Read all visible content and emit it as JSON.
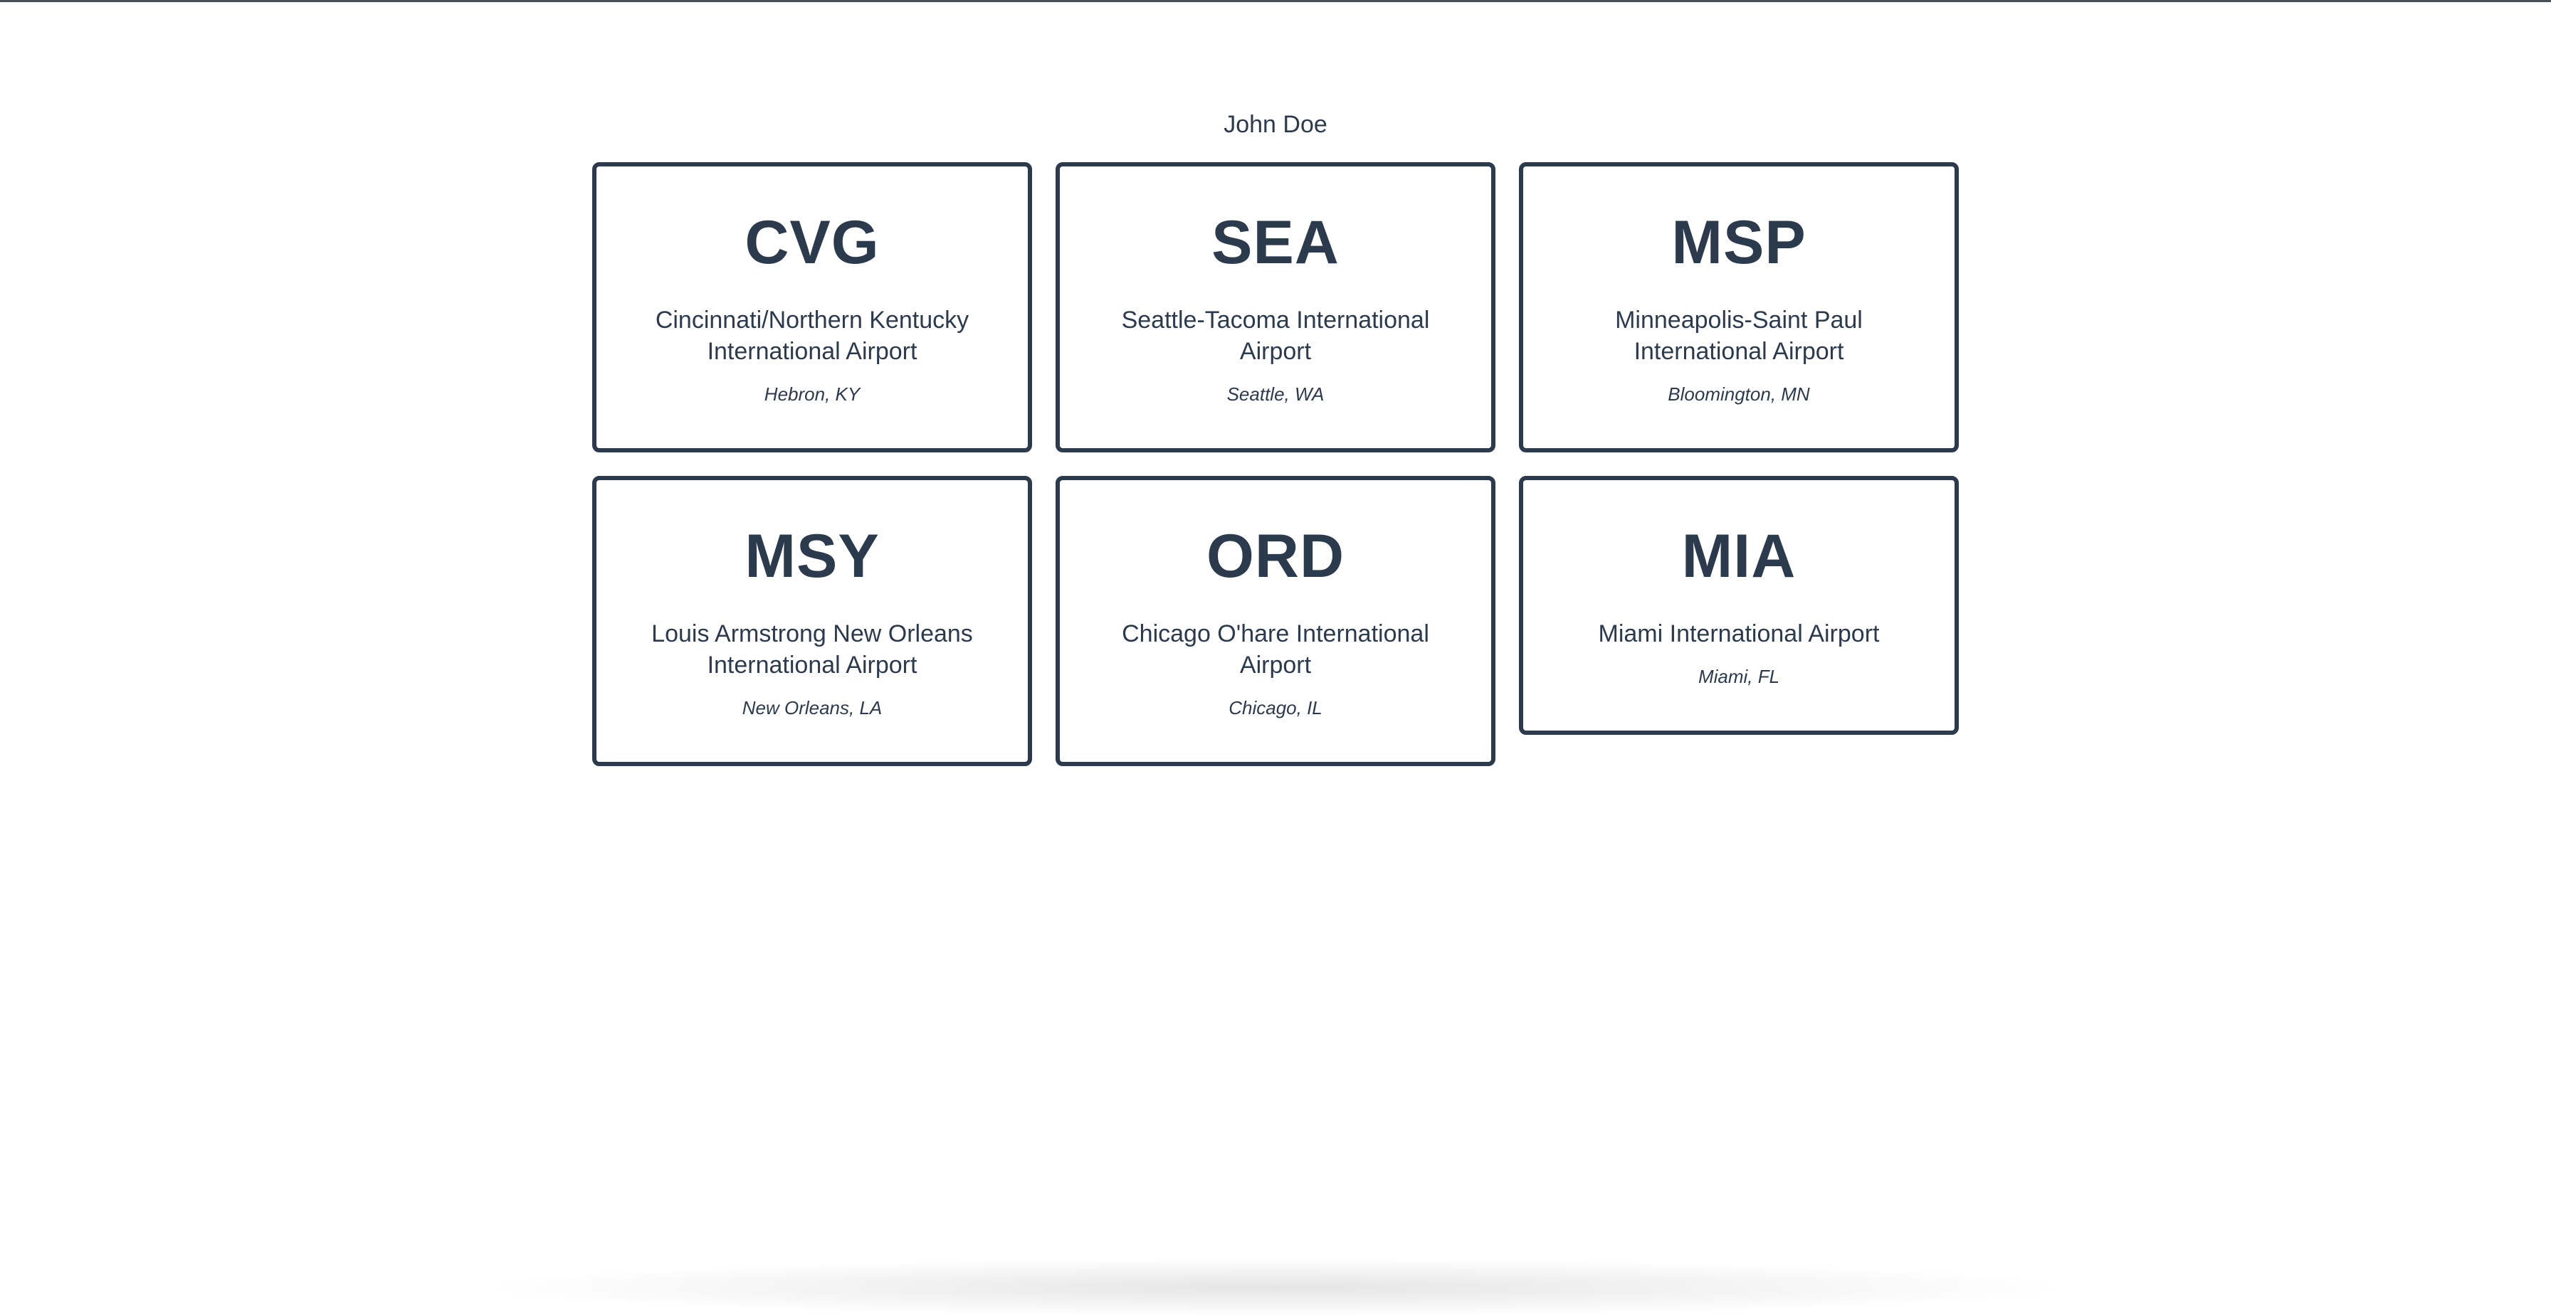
{
  "user": {
    "name": "John Doe"
  },
  "colors": {
    "text": "#2c3a4d",
    "card_border": "#2c3a4d",
    "background": "#ffffff"
  },
  "airports": [
    {
      "code": "CVG",
      "name": "Cincinnati/Northern Kentucky International Airport",
      "location": "Hebron, KY"
    },
    {
      "code": "SEA",
      "name": "Seattle-Tacoma International Airport",
      "location": "Seattle, WA"
    },
    {
      "code": "MSP",
      "name": "Minneapolis-Saint Paul International Airport",
      "location": "Bloomington, MN"
    },
    {
      "code": "MSY",
      "name": "Louis Armstrong New Orleans International Airport",
      "location": "New Orleans, LA"
    },
    {
      "code": "ORD",
      "name": "Chicago O'hare International Airport",
      "location": "Chicago, IL"
    },
    {
      "code": "MIA",
      "name": "Miami International Airport",
      "location": "Miami, FL"
    }
  ]
}
